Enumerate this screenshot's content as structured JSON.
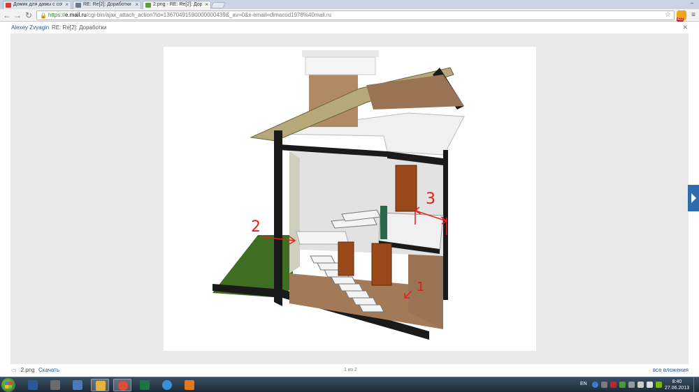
{
  "browser": {
    "tabs": [
      {
        "title": "Домик для дамы с собак",
        "favicon_color": "#d23f31",
        "active": false
      },
      {
        "title": "RE: Re[2]: Доработки - di",
        "favicon_color": "#6a7a8a",
        "active": false
      },
      {
        "title": "2.png - RE: Re[2]: Доработ",
        "favicon_color": "#5a9e4a",
        "active": true
      }
    ],
    "url": {
      "scheme": "https://",
      "host": "e.mail.ru",
      "path": "/cgi-bin/ajax_attach_action?id=13670491590000000439&_av=0&x-email=dimacod1978%40mail.ru"
    },
    "extension_badge": "422"
  },
  "viewer": {
    "sender": "Alexey Zvyagin",
    "subject": "RE: Re[2]: Доработки",
    "image_alt": "3D cutaway of two-storey house with staircase",
    "annotations": [
      "1",
      "2",
      "3"
    ],
    "footer": {
      "filename": "2.png",
      "download_label": "Скачать",
      "counter": "1 из 2",
      "all_attachments": "все вложения"
    }
  },
  "taskbar": {
    "apps": [
      {
        "name": "word-icon",
        "color": "#2b5797"
      },
      {
        "name": "tanks-icon",
        "color": "#6b6b6b"
      },
      {
        "name": "app3-icon",
        "color": "#4a7ab8"
      },
      {
        "name": "explorer-icon",
        "color": "#e2b23a"
      },
      {
        "name": "chrome-icon",
        "color": "#dd4b39"
      },
      {
        "name": "excel-icon",
        "color": "#1e7145"
      },
      {
        "name": "ie-icon",
        "color": "#3a8fd6"
      },
      {
        "name": "media-icon",
        "color": "#e07a1a"
      }
    ],
    "language": "EN",
    "time": "8:40",
    "date": "27.06.2013"
  }
}
